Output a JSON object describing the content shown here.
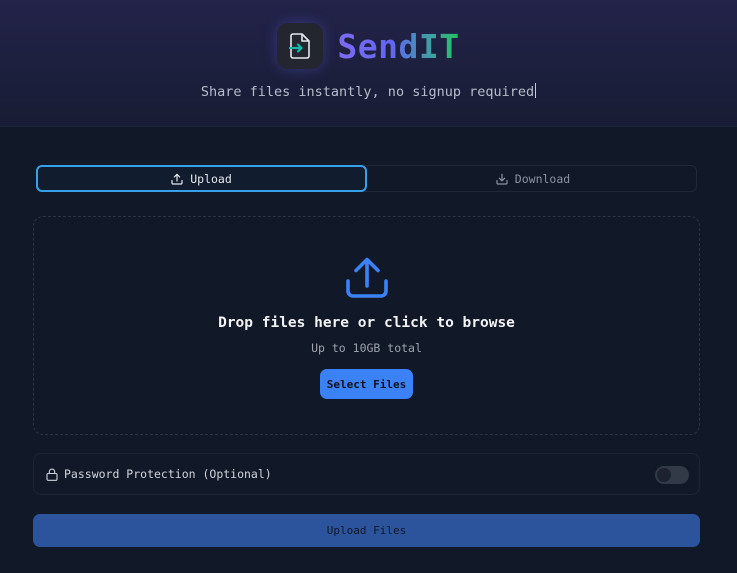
{
  "header": {
    "brand": "SendIT",
    "tagline": "Share files instantly, no signup required",
    "logo_icon": "file-arrow-in-icon"
  },
  "tabs": [
    {
      "label": "Upload",
      "icon": "upload-icon",
      "active": true
    },
    {
      "label": "Download",
      "icon": "download-icon",
      "active": false
    }
  ],
  "dropzone": {
    "icon": "upload-large-icon",
    "title": "Drop files here or click to browse",
    "subtitle": "Up to 10GB total",
    "button_label": "Select Files"
  },
  "password": {
    "icon": "lock-icon",
    "label": "Password Protection (Optional)",
    "enabled": false
  },
  "submit": {
    "label": "Upload Files"
  },
  "colors": {
    "accent": "#3b82f6",
    "active_tab_border": "#38a0e8",
    "background": "#111827",
    "submit_button": "#2c549c"
  }
}
